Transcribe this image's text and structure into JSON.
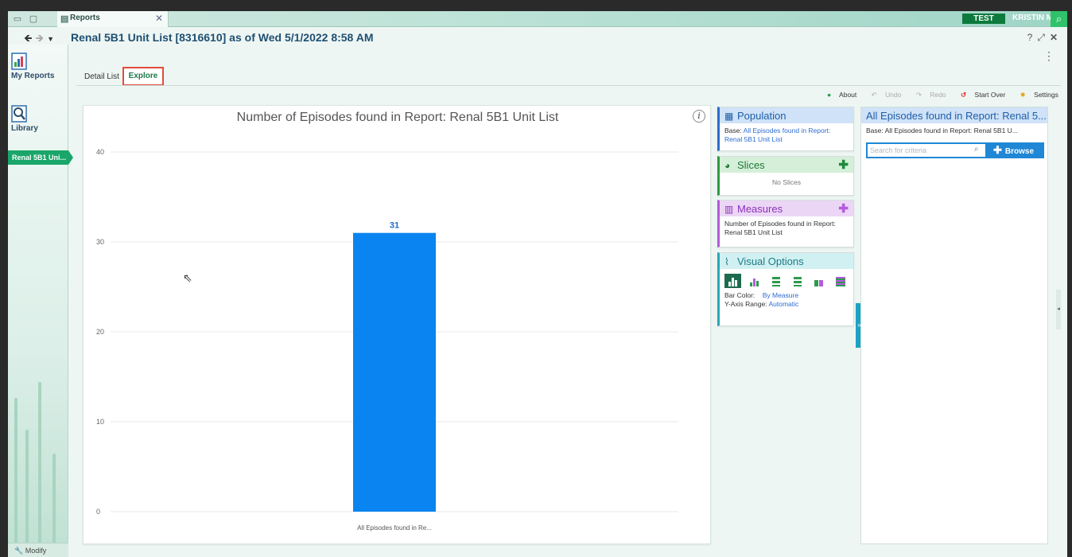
{
  "window": {
    "tab_label": "Reports",
    "env_badge": "TEST",
    "user_name": "KRISTIN M."
  },
  "header": {
    "title": "Renal 5B1  Unit List [8316610] as of Wed 5/1/2022  8:58 AM"
  },
  "sidebar": {
    "my_reports": "My Reports",
    "library": "Library",
    "active_report": "Renal 5B1 Uni...",
    "modify": "Modify"
  },
  "report_tabs": {
    "detail_list": "Detail List",
    "explore": "Explore"
  },
  "toolbar": {
    "about": "About",
    "undo": "Undo",
    "redo": "Redo",
    "start_over": "Start Over",
    "settings": "Settings"
  },
  "population": {
    "title": "Population",
    "base_label": "Base:",
    "base_value": "All Episodes found in Report: Renal 5B1 Unit List"
  },
  "slices": {
    "title": "Slices",
    "empty": "No Slices"
  },
  "measures": {
    "title": "Measures",
    "value": "Number of Episodes found in Report: Renal 5B1 Unit List"
  },
  "visual_options": {
    "title": "Visual Options",
    "bar_color_label": "Bar Color:",
    "bar_color_value": "By Measure",
    "y_axis_label": "Y-Axis Range:",
    "y_axis_value": "Automatic"
  },
  "criteria": {
    "title": "All Episodes found in Report: Renal 5...",
    "base": "Base: All Episodes found in Report: Renal 5B1 U...",
    "search_placeholder": "Search for criteria",
    "browse": "Browse"
  },
  "colors": {
    "bar": "#0a84f0",
    "accent": "#1aa66a"
  },
  "chart_data": {
    "type": "bar",
    "title": "Number of Episodes found in Report: Renal 5B1 Unit List",
    "categories": [
      "All Episodes found in Re..."
    ],
    "values": [
      31
    ],
    "yticks": [
      0,
      10,
      20,
      30,
      40
    ],
    "ylim": [
      0,
      40
    ],
    "grid": true,
    "xlabel": "",
    "ylabel": ""
  }
}
